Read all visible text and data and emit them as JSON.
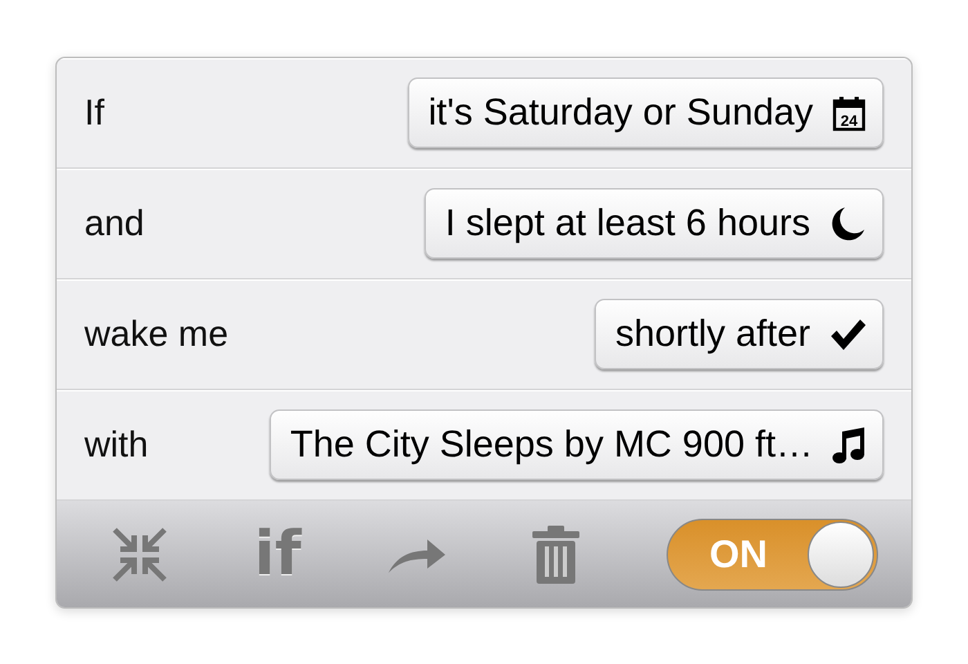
{
  "rules": [
    {
      "label": "If",
      "value": "it's Saturday or Sunday",
      "kind": "calendar",
      "icon_text": "24"
    },
    {
      "label": "and",
      "value": "I slept at least 6 hours",
      "kind": "moon"
    },
    {
      "label": "wake me",
      "value": "shortly after",
      "kind": "check"
    },
    {
      "label": "with",
      "value": "The City Sleeps by MC 900 ft…",
      "kind": "note"
    }
  ],
  "toolbar": [
    {
      "kind": "collapse"
    },
    {
      "kind": "text",
      "text": "if"
    },
    {
      "kind": "share"
    },
    {
      "kind": "trash"
    }
  ],
  "toggle": {
    "label": "ON",
    "on": true
  }
}
